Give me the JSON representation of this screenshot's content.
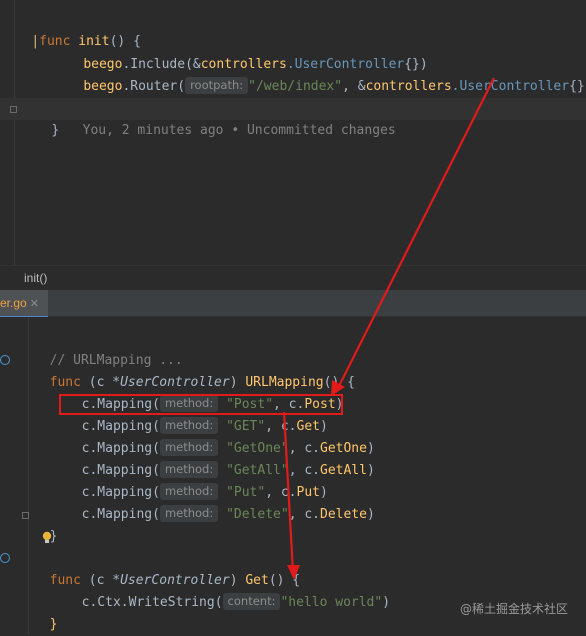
{
  "top_code": {
    "line1_kw": "func",
    "line1_fn": "init",
    "line1_rest": "() {",
    "line2_pkg": "beego",
    "line2_call": ".Include(&",
    "line2_pkg2": "controllers",
    "line2_type": ".UserController",
    "line2_end": "{})",
    "line3_pkg": "beego",
    "line3_call": ".Router(",
    "line3_hint": "rootpath:",
    "line3_str": "\"/web/index\"",
    "line3_mid": ", &",
    "line3_pkg2": "controllers",
    "line3_type": ".UserController",
    "line3_end": "{})",
    "line4_brace": "}",
    "line4_blame": "You, 2 minutes ago • Uncommitted changes"
  },
  "status_bar": {
    "breadcrumb": "init()"
  },
  "tab": {
    "label": "er.go",
    "close": "✕"
  },
  "bottom_code": {
    "comment": "// URLMapping ...",
    "sig1_kw": "func",
    "sig1_recv": "(c *",
    "sig1_type": "UserController",
    "sig1_paren": ")",
    "sig1_name": "URLMapping",
    "sig1_end": "() {",
    "mappings": [
      {
        "call": "c.Mapping(",
        "hint": "method:",
        "str": "\"Post\"",
        "mid": ", c.",
        "fn": "Post",
        "end": ")"
      },
      {
        "call": "c.Mapping(",
        "hint": "method:",
        "str": "\"GET\"",
        "mid": ", c.",
        "fn": "Get",
        "end": ")"
      },
      {
        "call": "c.Mapping(",
        "hint": "method:",
        "str": "\"GetOne\"",
        "mid": ", c.",
        "fn": "GetOne",
        "end": ")"
      },
      {
        "call": "c.Mapping(",
        "hint": "method:",
        "str": "\"GetAll\"",
        "mid": ", c.",
        "fn": "GetAll",
        "end": ")"
      },
      {
        "call": "c.Mapping(",
        "hint": "method:",
        "str": "\"Put\"",
        "mid": ", c.",
        "fn": "Put",
        "end": ")"
      },
      {
        "call": "c.Mapping(",
        "hint": "method:",
        "str": "\"Delete\"",
        "mid": ", c.",
        "fn": "Delete",
        "end": ")"
      }
    ],
    "close1": "}",
    "sig2_kw": "func",
    "sig2_recv": "(c *",
    "sig2_type": "UserController",
    "sig2_paren": ")",
    "sig2_name": "Get",
    "sig2_end": "() {",
    "body_call": "c.Ctx.WriteString(",
    "body_hint": "content:",
    "body_str": "\"hello world\"",
    "body_end": ")",
    "close2": "}"
  },
  "watermark": "@稀土掘金技术社区",
  "colors": {
    "annotation_red": "#e11a1a",
    "keyword": "#cc7832",
    "function": "#ffc66d",
    "string": "#6a8759"
  }
}
